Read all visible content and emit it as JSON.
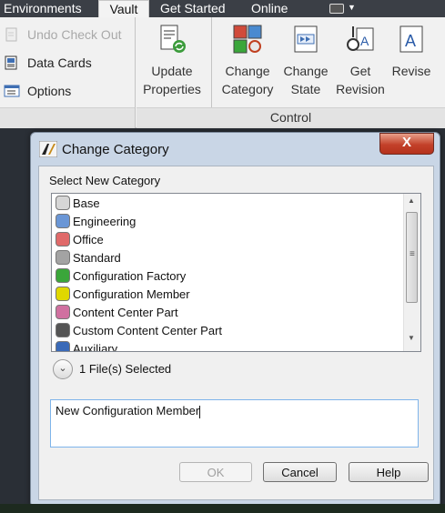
{
  "ribbon": {
    "tabs": [
      "Environments",
      "Vault",
      "Get Started",
      "Online"
    ],
    "active_tab": "Vault",
    "small_commands": [
      {
        "label": "Undo Check Out",
        "icon": "undo-checkout-icon",
        "enabled": false
      },
      {
        "label": "Data Cards",
        "icon": "data-cards-icon",
        "enabled": true
      },
      {
        "label": "Options",
        "icon": "options-icon",
        "enabled": true
      }
    ],
    "update_properties": {
      "line1": "Update",
      "line2": "Properties"
    },
    "change_category": {
      "line1": "Change",
      "line2": "Category"
    },
    "change_state": {
      "line1": "Change",
      "line2": "State"
    },
    "get_revision": {
      "line1": "Get",
      "line2": "Revision"
    },
    "revise": {
      "line1": "Revise"
    },
    "control_group_label": "Control"
  },
  "dialog": {
    "title": "Change Category",
    "close_label": "X",
    "select_label": "Select New Category",
    "categories": [
      {
        "name": "Base",
        "color": "#d6d6d6"
      },
      {
        "name": "Engineering",
        "color": "#6a96d6"
      },
      {
        "name": "Office",
        "color": "#e06a6a"
      },
      {
        "name": "Standard",
        "color": "#a3a3a3"
      },
      {
        "name": "Configuration Factory",
        "color": "#3aa63a"
      },
      {
        "name": "Configuration Member",
        "color": "#e0d800"
      },
      {
        "name": "Content Center Part",
        "color": "#d070a0"
      },
      {
        "name": "Custom Content Center Part",
        "color": "#555555"
      },
      {
        "name": "Auxiliary",
        "color": "#3a6ab8"
      }
    ],
    "files_selected": "1 File(s) Selected",
    "comment_value": "New Configuration Member",
    "ok_label": "OK",
    "cancel_label": "Cancel",
    "help_label": "Help"
  }
}
